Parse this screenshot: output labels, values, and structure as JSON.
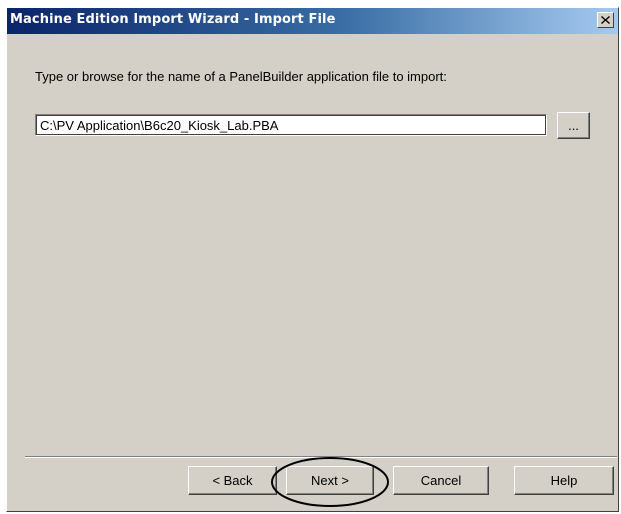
{
  "window": {
    "title": "Machine Edition Import Wizard - Import File",
    "close_glyph": "×"
  },
  "content": {
    "prompt": "Type or browse for the name of a PanelBuilder application file to import:",
    "file_path": "C:\\PV Application\\B6c20_Kiosk_Lab.PBA",
    "browse_label": "..."
  },
  "buttons": {
    "back": "< Back",
    "next": "Next >",
    "cancel": "Cancel",
    "help": "Help"
  },
  "colors": {
    "dialog_face": "#d4d0c8",
    "titlebar_start": "#0a246a",
    "titlebar_end": "#a6caf0",
    "annotation_ellipse": "#000000"
  }
}
